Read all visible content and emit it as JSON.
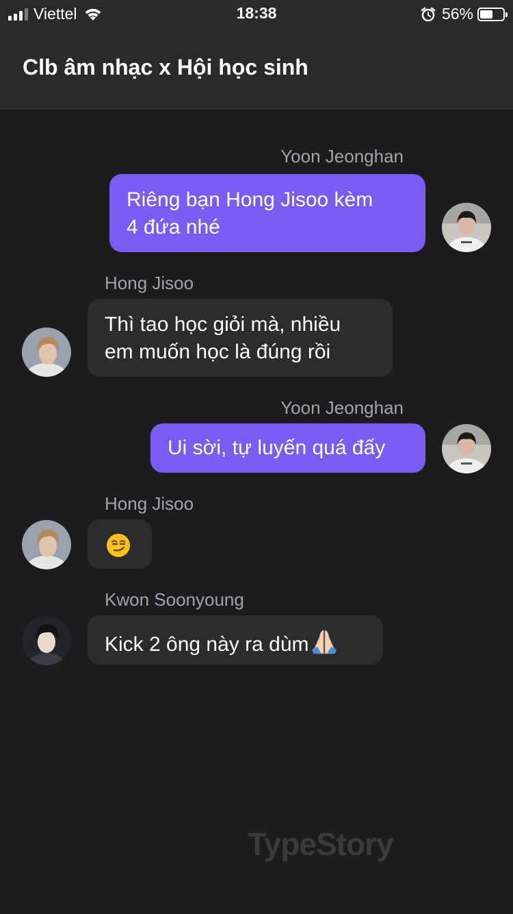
{
  "status_bar": {
    "carrier": "Viettel",
    "time": "18:38",
    "battery_percent": "56%",
    "battery_level": 0.56
  },
  "header": {
    "title": "Clb âm nhạc x Hội học sinh"
  },
  "messages": [
    {
      "sender": "Yoon Jeonghan",
      "lines": [
        "Riêng bạn Hong Jisoo kèm",
        "4 đứa nhé"
      ],
      "direction": "outgoing"
    },
    {
      "sender": "Hong Jisoo",
      "lines": [
        "Thì tao học giỏi mà, nhiều",
        "em muốn học là đúng rồi"
      ],
      "direction": "incoming"
    },
    {
      "sender": "Yoon Jeonghan",
      "lines": [
        "Ui sời, tự luyến quá đấy"
      ],
      "direction": "outgoing"
    },
    {
      "sender": "Hong Jisoo",
      "lines": [
        ""
      ],
      "emoji": "smirking-face",
      "direction": "incoming"
    },
    {
      "sender": "Kwon Soonyoung",
      "lines": [
        "Kick 2 ông này ra dùm"
      ],
      "emoji": "folded-hands",
      "direction": "incoming"
    }
  ],
  "watermark": "TypeStory",
  "colors": {
    "background": "#1c1c1e",
    "header": "#2a2a2c",
    "outgoing_bubble": "#7a5cf5",
    "incoming_bubble": "#2c2c2e",
    "sender_name": "#a3a3a8"
  }
}
